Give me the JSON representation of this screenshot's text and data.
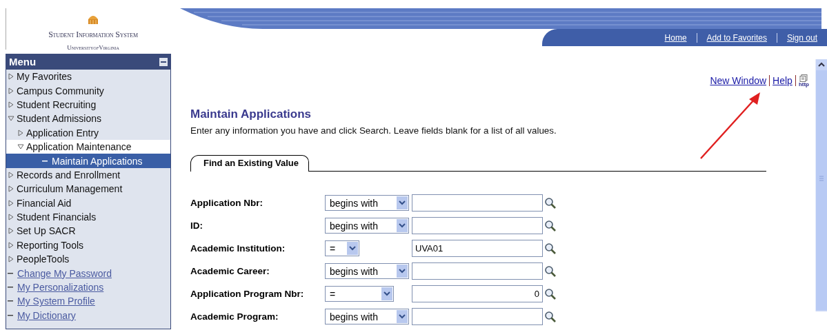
{
  "logo": {
    "title": "Student Information System",
    "subtitle_before": "University",
    "subtitle_of": "of",
    "subtitle_after": "Virginia"
  },
  "nav": [
    "Home",
    "Add to Favorites",
    "Sign out"
  ],
  "menu": {
    "title": "Menu",
    "items": [
      {
        "label": "My Favorites",
        "kind": "folder",
        "expanded": false,
        "selected": false,
        "hovered": false
      },
      {
        "label": "Campus Community",
        "kind": "folder",
        "expanded": false,
        "selected": false,
        "hovered": false
      },
      {
        "label": "Student Recruiting",
        "kind": "folder",
        "expanded": false,
        "selected": false,
        "hovered": false
      },
      {
        "label": "Student Admissions",
        "kind": "folder",
        "expanded": true,
        "selected": false,
        "hovered": false,
        "children": [
          {
            "label": "Application Entry",
            "kind": "folder",
            "expanded": false,
            "selected": false,
            "hovered": false
          },
          {
            "label": "Application Maintenance",
            "kind": "folder",
            "expanded": true,
            "selected": false,
            "hovered": true,
            "children": [
              {
                "label": "Maintain Applications",
                "kind": "page",
                "selected": true,
                "hovered": false
              }
            ]
          }
        ]
      },
      {
        "label": "Records and Enrollment",
        "kind": "folder",
        "expanded": false,
        "selected": false,
        "hovered": false
      },
      {
        "label": "Curriculum Management",
        "kind": "folder",
        "expanded": false,
        "selected": false,
        "hovered": false
      },
      {
        "label": "Financial Aid",
        "kind": "folder",
        "expanded": false,
        "selected": false,
        "hovered": false
      },
      {
        "label": "Student Financials",
        "kind": "folder",
        "expanded": false,
        "selected": false,
        "hovered": false
      },
      {
        "label": "Set Up SACR",
        "kind": "folder",
        "expanded": false,
        "selected": false,
        "hovered": false
      },
      {
        "label": "Reporting Tools",
        "kind": "folder",
        "expanded": false,
        "selected": false,
        "hovered": false
      },
      {
        "label": "PeopleTools",
        "kind": "folder",
        "expanded": false,
        "selected": false,
        "hovered": false
      },
      {
        "label": "Change My Password",
        "kind": "link",
        "selected": false,
        "hovered": false
      },
      {
        "label": "My Personalizations",
        "kind": "link",
        "selected": false,
        "hovered": false
      },
      {
        "label": "My System Profile",
        "kind": "link",
        "selected": false,
        "hovered": false
      },
      {
        "label": "My Dictionary",
        "kind": "link",
        "selected": false,
        "hovered": false
      }
    ]
  },
  "page_links": [
    "New Window",
    "Help"
  ],
  "http_label": "http",
  "title": "Maintain Applications",
  "instructions": "Enter any information you have and click Search. Leave fields blank for a list of all values.",
  "tabs": [
    {
      "label": "Find an Existing Value",
      "selected": true
    }
  ],
  "fields": [
    {
      "label": "Application Nbr:",
      "kind": "text",
      "operator": "begins with"
    },
    {
      "label": "ID:",
      "kind": "text",
      "operator": "begins with"
    },
    {
      "label": "Academic Institution:",
      "kind": "key",
      "operator": "=",
      "value": "UVA01"
    },
    {
      "label": "Academic Career:",
      "kind": "text",
      "operator": "begins with"
    },
    {
      "label": "Application Program Nbr:",
      "kind": "number",
      "operator": "=",
      "value": "0"
    },
    {
      "label": "Academic Program:",
      "kind": "text",
      "operator": "begins with"
    }
  ]
}
